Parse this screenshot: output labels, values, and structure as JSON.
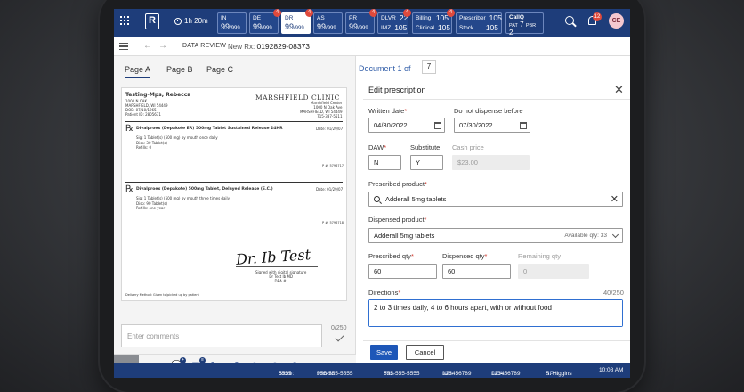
{
  "header": {
    "timer": "1h 20m",
    "tabs": [
      {
        "label": "IN",
        "count": "99",
        "total": "/999",
        "badge": ""
      },
      {
        "label": "DE",
        "count": "99",
        "total": "/999",
        "badge": "4"
      },
      {
        "label": "DR",
        "count": "99",
        "total": "/999",
        "badge": "4"
      },
      {
        "label": "AS",
        "count": "99",
        "total": "/999",
        "badge": ""
      },
      {
        "label": "PR",
        "count": "99",
        "total": "/999",
        "badge": "4"
      }
    ],
    "groups": [
      {
        "rows": [
          {
            "label": "DLVR",
            "value": "22"
          },
          {
            "label": "IMZ",
            "value": "105"
          }
        ],
        "badge": "4"
      },
      {
        "rows": [
          {
            "label": "Billing",
            "value": "105"
          },
          {
            "label": "Clinical",
            "value": "105"
          }
        ],
        "badge": "4"
      },
      {
        "rows": [
          {
            "label": "Prescriber",
            "value": "105"
          },
          {
            "label": "Stock",
            "value": "105"
          }
        ],
        "badge": ""
      }
    ],
    "calliq": {
      "title": "CallQ",
      "pat_label": "PAT",
      "pat_value": "7",
      "pbr_label": "PBR",
      "pbr_value": "2"
    },
    "notification_count": "12",
    "user_initials": "CE"
  },
  "breadcrumb": {
    "title": "DATA REVIEW",
    "rx_label": "New Rx:",
    "rx_number": "0192829-08373"
  },
  "document": {
    "page_tabs": [
      "Page A",
      "Page B",
      "Page C"
    ],
    "doc_of_label": "Document 1 of",
    "doc_count": "7",
    "image": {
      "patient_name": "Testing-Mps, Rebecca",
      "patient_addr": [
        "1000 N OAK",
        "MARSHFIELD, WI 54449",
        "DOB: 07/10/1965",
        "Patient ID: 2805631"
      ],
      "clinic": "MARSHFIELD CLINIC",
      "clinic_addr": [
        "Marshfield Center",
        "1000 N Oak Ave",
        "MARSHFIELD, WI 54449",
        "715-387-5511"
      ],
      "rx1_drug": "Divalproex (Depakote ER) 500mg Tablet Sustained Release 24HR",
      "rx1_date": "Date: 01/29/07",
      "rx1_sig": [
        "Sig:    1 Tablet(s) (500 mg) by mouth once daily",
        "Disp:   30 Tablet(s)",
        "Refills:  0"
      ],
      "rx1_pnum": "P #: 5796717",
      "rx2_drug": "Divalproex (Depakote) 500mg Tablet, Delayed Release (E.C.)",
      "rx2_date": "Date: 01/29/07",
      "rx2_sig": [
        "Sig:    1 Tablet(s) (500 mg) by mouth three times daily",
        "Disp:   90 Tablet(s)",
        "Refills:  one year"
      ],
      "rx2_pnum": "P #: 5796718",
      "signature": "Dr. Ib Test",
      "signed_note": [
        "Signed with digital signature",
        "Dr Test Ib MD",
        "DEA #:"
      ],
      "delivery_note": "Delivery Method: Given to/picked up by patient"
    },
    "comment_placeholder": "Enter comments",
    "comment_count": "0/250"
  },
  "edit": {
    "title": "Edit prescription",
    "written_date_label": "Written date",
    "written_date": "04/30/2022",
    "dnd_label": "Do not dispense before",
    "dnd_date": "07/30/2022",
    "daw_label": "DAW",
    "daw_value": "N",
    "substitute_label": "Substitute",
    "substitute_value": "Y",
    "cash_price_label": "Cash price",
    "cash_price": "$23.00",
    "prescribed_label": "Prescribed product",
    "prescribed_value": "Adderall 5mg tablets",
    "dispensed_label": "Dispensed product",
    "dispensed_value": "Adderall 5mg tablets",
    "available_qty": "Available qty: 33",
    "prescribed_qty_label": "Prescribed qty",
    "prescribed_qty": "60",
    "dispensed_qty_label": "Dispensed qty",
    "dispensed_qty": "60",
    "remaining_qty_label": "Remaining qty",
    "remaining_qty": "0",
    "directions_label": "Directions",
    "directions_count": "40/250",
    "directions": "2 to 3 times daily, 4 to 6 hours apart, with or without food",
    "save_label": "Save",
    "cancel_label": "Cancel"
  },
  "status": {
    "store_label": "Store:",
    "store": "5555",
    "phone_label": "Phone:",
    "phone": "555-555-5555",
    "fax_label": "Fax:",
    "fax": "555-555-5555",
    "npi_label": "NPI:",
    "npi": "123456789",
    "dea_label": "DEA:",
    "dea": "123456789",
    "rph_label": "RPh:",
    "rph": "S. Higgins",
    "time": "10:08 AM"
  }
}
